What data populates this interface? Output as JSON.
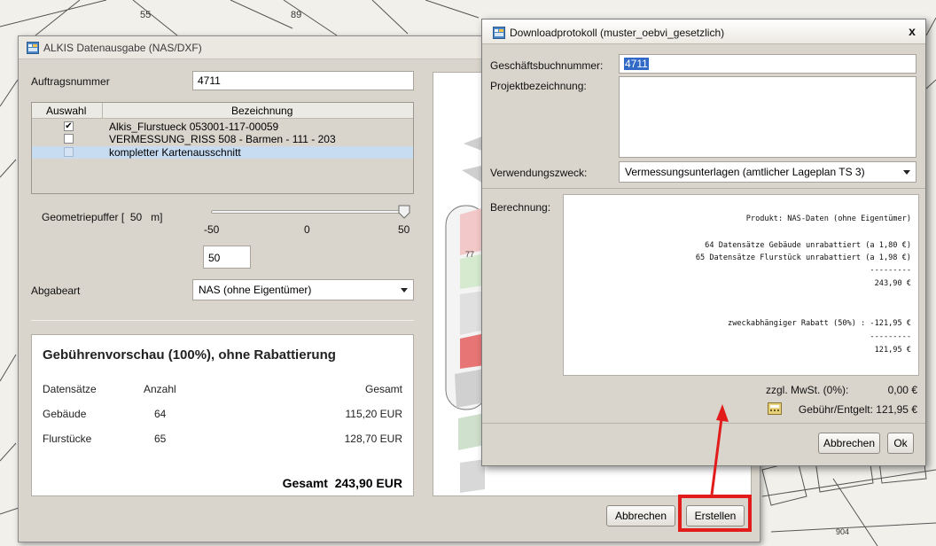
{
  "main_dialog": {
    "title": "ALKIS Datenausgabe (NAS/DXF)",
    "auftragsnummer_label": "Auftragsnummer",
    "auftragsnummer_value": "4711",
    "table": {
      "col_auswahl": "Auswahl",
      "col_bezeichnung": "Bezeichnung",
      "rows": [
        {
          "checked": "✔",
          "label": "Alkis_Flurstueck 053001-117-00059"
        },
        {
          "checked": "",
          "label": "VERMESSUNG_RISS 508 - Barmen - 111 - 203"
        },
        {
          "checked": "",
          "label": "kompletter Kartenausschnitt"
        }
      ]
    },
    "geometriepuffer_label": "Geometriepuffer [  50   m]",
    "slider": {
      "min": "-50",
      "mid": "0",
      "max": "50",
      "value": 50
    },
    "buffer_value": "50",
    "abgabeart_label": "Abgabeart",
    "abgabeart_value": "NAS (ohne Eigentümer)",
    "fee_preview": {
      "title": "Gebührenvorschau (100%), ohne Rabattierung",
      "headers": {
        "datensaetze": "Datensätze",
        "anzahl": "Anzahl",
        "gesamt": "Gesamt"
      },
      "rows": [
        {
          "name": "Gebäude",
          "count": "64",
          "total": "115,20 EUR"
        },
        {
          "name": "Flurstücke",
          "count": "65",
          "total": "128,70 EUR"
        }
      ],
      "total_label": "Gesamt",
      "total_value": "243,90 EUR"
    },
    "buttons": {
      "cancel": "Abbrechen",
      "create": "Erstellen"
    }
  },
  "download_dialog": {
    "title": "Downloadprotokoll (muster_oebvi_gesetzlich)",
    "close": "x",
    "geschaeftsbuchnummer_label": "Geschäftsbuchnummer:",
    "geschaeftsbuchnummer_value": "4711",
    "projektbezeichnung_label": "Projektbezeichnung:",
    "projektbezeichnung_value": "",
    "verwendungszweck_label": "Verwendungszweck:",
    "verwendungszweck_value": "Vermessungsunterlagen (amtlicher Lageplan TS 3)",
    "berechnung_label": "Berechnung:",
    "berechnung_lines": [
      "Produkt: NAS-Daten (ohne Eigentümer)",
      "64 Datensätze Gebäude unrabattiert (a 1,80 €)",
      "65 Datensätze Flurstück unrabattiert (a 1,98 €)",
      "---------",
      "243,90 €",
      "zweckabhängiger Rabatt (50%) : -121,95 €",
      "---------",
      "121,95 €"
    ],
    "mwst_label": "zzgl. MwSt. (0%):",
    "mwst_value": "0,00 €",
    "gebuehr_label": "Gebühr/Entgelt: 121,95 €",
    "buttons": {
      "cancel": "Abbrechen",
      "ok": "Ok"
    }
  },
  "map_labels": {
    "a": "55",
    "b": "89",
    "c": "904"
  },
  "colors": {
    "highlight": "#e21b1b",
    "selection": "#c7dbf1"
  }
}
